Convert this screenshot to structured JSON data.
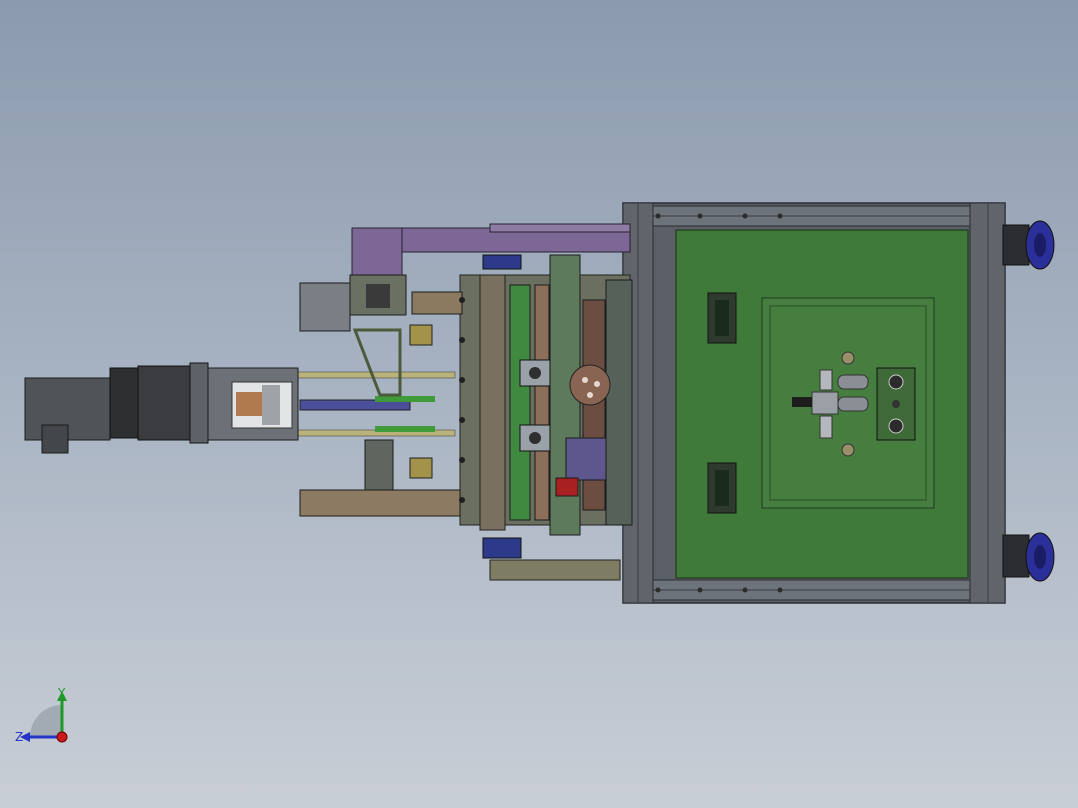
{
  "viewport": {
    "background_top": "#8b9aae",
    "background_bottom": "#c9ced6"
  },
  "model": {
    "frame_color": "#5a5f66",
    "panel_color": "#3f7a3a",
    "accent_purple": "#7d6796",
    "accent_blue": "#2a2f9a",
    "motor_color": "#505357"
  },
  "triad": {
    "y_label": "Y",
    "z_label": "Z",
    "y_color": "#1f9a2a",
    "z_color": "#2436c8",
    "x_color": "#cc1a1a"
  }
}
